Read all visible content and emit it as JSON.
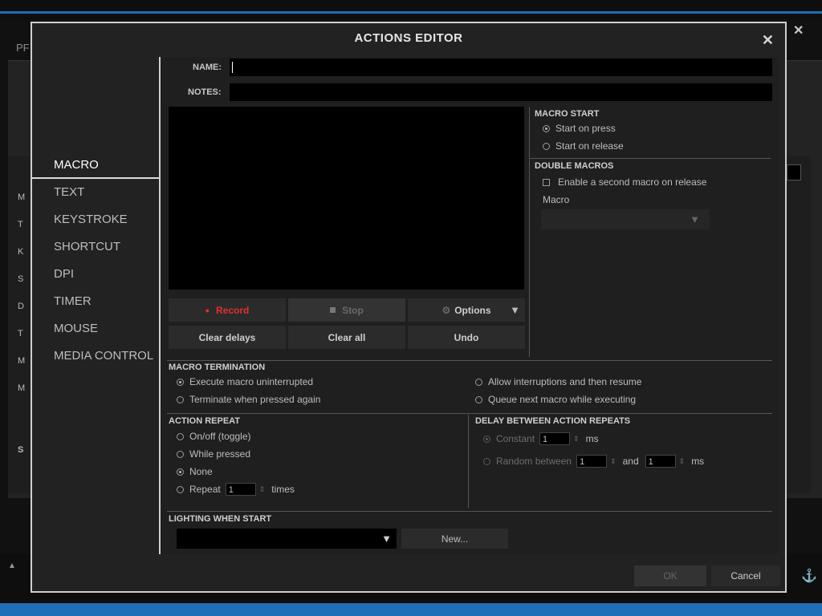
{
  "background": {
    "title_fragment": "PF",
    "left_letters": [
      "M",
      "T",
      "K",
      "S",
      "D",
      "T",
      "M",
      "M"
    ],
    "s_letter": "S",
    "close_glyph": "✕"
  },
  "modal": {
    "title": "ACTIONS EDITOR",
    "close_glyph": "✕"
  },
  "nav": {
    "items": [
      {
        "label": "MACRO"
      },
      {
        "label": "TEXT"
      },
      {
        "label": "KEYSTROKE"
      },
      {
        "label": "SHORTCUT"
      },
      {
        "label": "DPI"
      },
      {
        "label": "TIMER"
      },
      {
        "label": "MOUSE"
      },
      {
        "label": "MEDIA CONTROL"
      }
    ]
  },
  "form": {
    "name_label": "NAME:",
    "name_value": "",
    "notes_label": "NOTES:",
    "notes_value": ""
  },
  "macro_buttons": {
    "record": "Record",
    "stop": "Stop",
    "options": "Options",
    "clear_delays": "Clear delays",
    "clear_all": "Clear all",
    "undo": "Undo"
  },
  "macro_start": {
    "title": "MACRO START",
    "options": [
      "Start on press",
      "Start on release"
    ],
    "selected": "Start on press"
  },
  "double_macros": {
    "title": "DOUBLE MACROS",
    "checkbox_label": "Enable a second macro on release",
    "macro_label": "Macro",
    "macro_value": ""
  },
  "macro_termination": {
    "title": "MACRO TERMINATION",
    "options": [
      "Execute macro uninterrupted",
      "Terminate when pressed again",
      "Allow interruptions and then resume",
      "Queue next macro while executing"
    ],
    "selected": "Execute macro uninterrupted"
  },
  "action_repeat": {
    "title": "ACTION REPEAT",
    "options": [
      "On/off (toggle)",
      "While pressed",
      "None",
      "Repeat"
    ],
    "selected": "None",
    "repeat_count": "1",
    "times_label": "times"
  },
  "delay_repeats": {
    "title": "DELAY BETWEEN ACTION REPEATS",
    "constant_label": "Constant",
    "constant_value": "1",
    "ms_label": "ms",
    "random_label": "Random between",
    "random_min": "1",
    "and_label": "and",
    "random_max": "1"
  },
  "lighting": {
    "title": "LIGHTING WHEN START",
    "value": "",
    "new_button": "New..."
  },
  "footer": {
    "ok": "OK",
    "cancel": "Cancel"
  }
}
